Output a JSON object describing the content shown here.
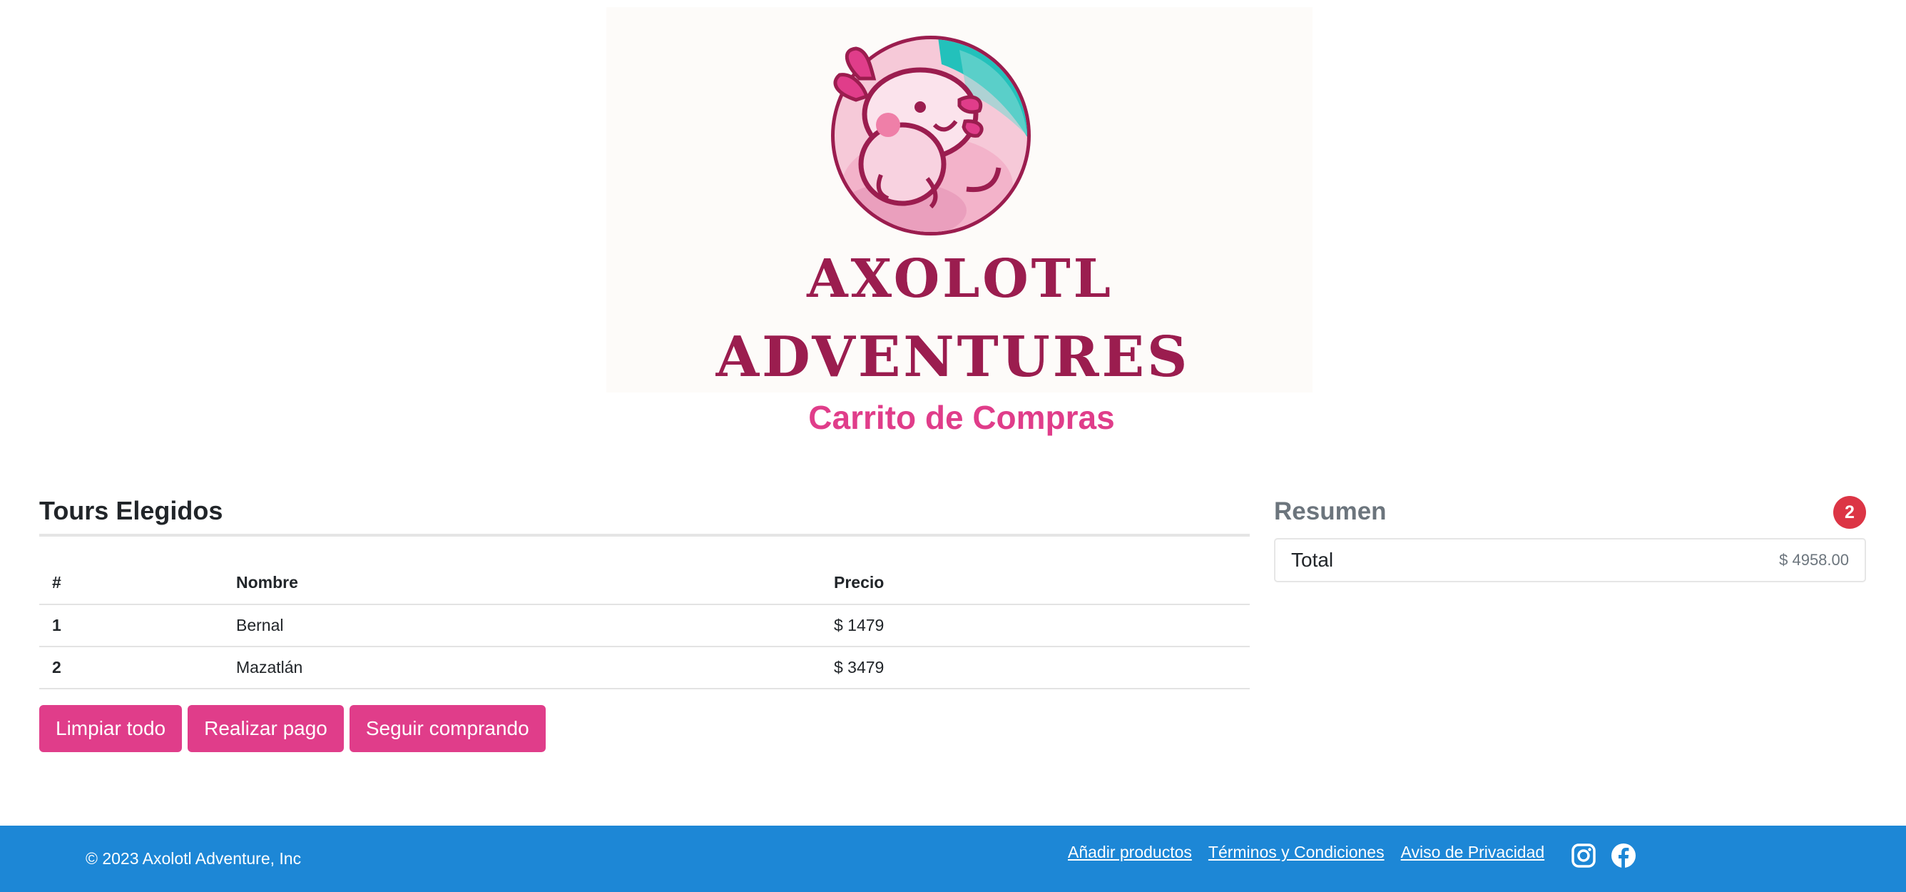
{
  "brand": {
    "line1": "AXOLOTL",
    "line2": "ADVENTURES"
  },
  "page_title": "Carrito de Compras",
  "tours": {
    "title": "Tours Elegidos",
    "columns": [
      "#",
      "Nombre",
      "Precio"
    ],
    "rows": [
      {
        "num": "1",
        "name": "Bernal",
        "price": "$ 1479"
      },
      {
        "num": "2",
        "name": "Mazatlán",
        "price": "$ 3479"
      }
    ],
    "buttons": {
      "clear": "Limpiar todo",
      "pay": "Realizar pago",
      "continue": "Seguir comprando"
    }
  },
  "summary": {
    "title": "Resumen",
    "count": "2",
    "total_label": "Total",
    "total_value": "$ 4958.00"
  },
  "footer": {
    "copyright": "© 2023 Axolotl Adventure, Inc",
    "links": [
      "Añadir productos",
      "Términos y Condiciones",
      "Aviso de Privacidad"
    ],
    "icons": [
      "instagram-icon",
      "facebook-icon"
    ]
  },
  "colors": {
    "accent_pink": "#e03d8a",
    "brand_maroon": "#9b1d4f",
    "footer_blue": "#1d87d6",
    "badge_red": "#dc3545"
  }
}
